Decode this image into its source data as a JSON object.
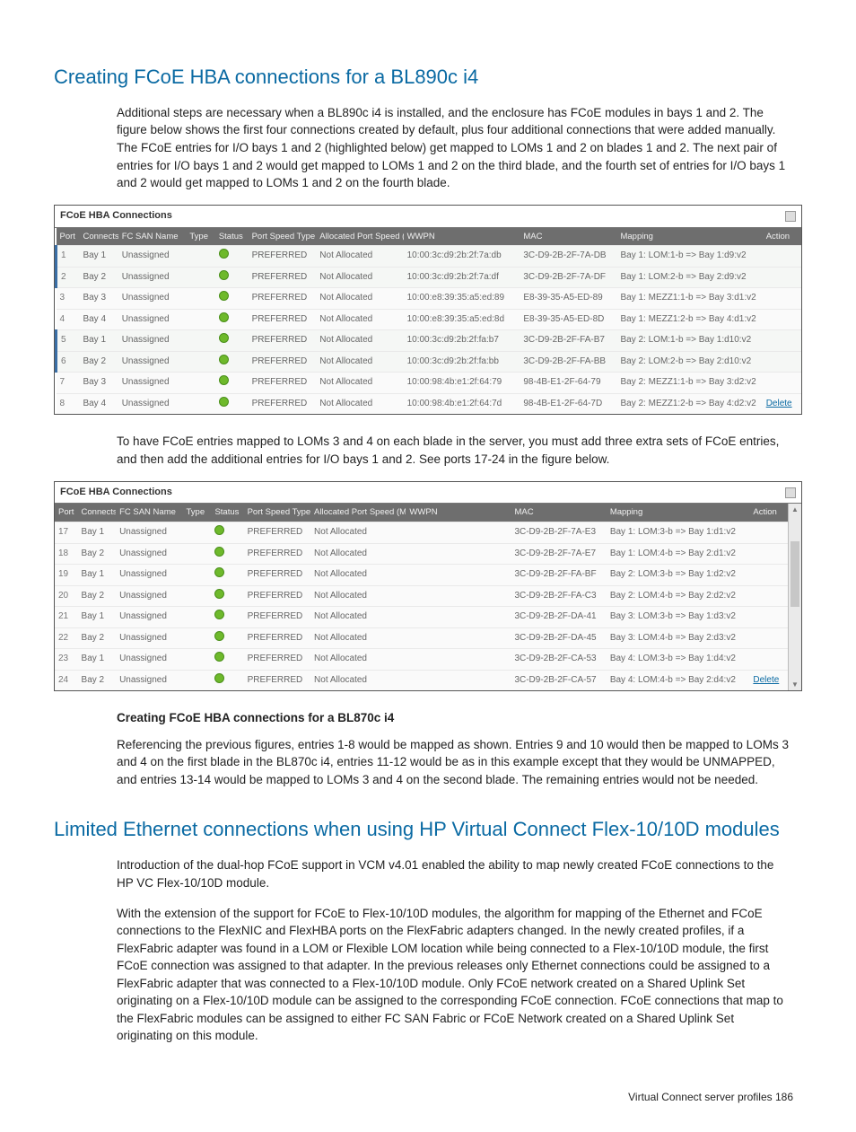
{
  "section1_title": "Creating FCoE HBA connections for a BL890c i4",
  "section1_p1": "Additional steps are necessary when a BL890c i4 is installed, and the enclosure has FCoE modules in bays 1 and 2. The figure below shows the first four connections created by default, plus four additional connections that were added manually. The FCoE entries for I/O bays 1 and 2 (highlighted below) get mapped to LOMs 1 and 2 on blades 1 and 2. The next pair of entries for I/O bays 1 and 2 would get mapped to LOMs 1 and 2 on the third blade, and the fourth set of entries for I/O bays 1 and 2 would get mapped to LOMs 1 and 2 on the fourth blade.",
  "fig1_title": "FCoE HBA Connections",
  "table_headers": {
    "port": "Port",
    "connects": "Connects",
    "fcsan": "FC SAN Name",
    "type": "Type",
    "status": "Status",
    "pst": "Port Speed Type",
    "aps": "Allocated Port Speed (Min-Max)",
    "wwpn": "WWPN",
    "mac": "MAC",
    "mapping": "Mapping",
    "action": "Action"
  },
  "fig1_rows": [
    {
      "port": "1",
      "hl": true,
      "bay": "Bay 1",
      "san": "Unassigned",
      "pst": "PREFERRED",
      "aps": "Not Allocated",
      "wwpn": "10:00:3c:d9:2b:2f:7a:db",
      "mac": "3C-D9-2B-2F-7A-DB",
      "map": "Bay 1: LOM:1-b => Bay 1:d9:v2",
      "del": false
    },
    {
      "port": "2",
      "hl": true,
      "bay": "Bay 2",
      "san": "Unassigned",
      "pst": "PREFERRED",
      "aps": "Not Allocated",
      "wwpn": "10:00:3c:d9:2b:2f:7a:df",
      "mac": "3C-D9-2B-2F-7A-DF",
      "map": "Bay 1: LOM:2-b => Bay 2:d9:v2",
      "del": false
    },
    {
      "port": "3",
      "hl": false,
      "bay": "Bay 3",
      "san": "Unassigned",
      "pst": "PREFERRED",
      "aps": "Not Allocated",
      "wwpn": "10:00:e8:39:35:a5:ed:89",
      "mac": "E8-39-35-A5-ED-89",
      "map": "Bay 1: MEZZ1:1-b => Bay 3:d1:v2",
      "del": false
    },
    {
      "port": "4",
      "hl": false,
      "bay": "Bay 4",
      "san": "Unassigned",
      "pst": "PREFERRED",
      "aps": "Not Allocated",
      "wwpn": "10:00:e8:39:35:a5:ed:8d",
      "mac": "E8-39-35-A5-ED-8D",
      "map": "Bay 1: MEZZ1:2-b => Bay 4:d1:v2",
      "del": false
    },
    {
      "port": "5",
      "hl": true,
      "bay": "Bay 1",
      "san": "Unassigned",
      "pst": "PREFERRED",
      "aps": "Not Allocated",
      "wwpn": "10:00:3c:d9:2b:2f:fa:b7",
      "mac": "3C-D9-2B-2F-FA-B7",
      "map": "Bay 2: LOM:1-b => Bay 1:d10:v2",
      "del": false
    },
    {
      "port": "6",
      "hl": true,
      "bay": "Bay 2",
      "san": "Unassigned",
      "pst": "PREFERRED",
      "aps": "Not Allocated",
      "wwpn": "10:00:3c:d9:2b:2f:fa:bb",
      "mac": "3C-D9-2B-2F-FA-BB",
      "map": "Bay 2: LOM:2-b => Bay 2:d10:v2",
      "del": false
    },
    {
      "port": "7",
      "hl": false,
      "bay": "Bay 3",
      "san": "Unassigned",
      "pst": "PREFERRED",
      "aps": "Not Allocated",
      "wwpn": "10:00:98:4b:e1:2f:64:79",
      "mac": "98-4B-E1-2F-64-79",
      "map": "Bay 2: MEZZ1:1-b => Bay 3:d2:v2",
      "del": false
    },
    {
      "port": "8",
      "hl": false,
      "bay": "Bay 4",
      "san": "Unassigned",
      "pst": "PREFERRED",
      "aps": "Not Allocated",
      "wwpn": "10:00:98:4b:e1:2f:64:7d",
      "mac": "98-4B-E1-2F-64-7D",
      "map": "Bay 2: MEZZ1:2-b => Bay 4:d2:v2",
      "del": true
    }
  ],
  "section1_p2": "To have FCoE entries mapped to LOMs 3 and 4 on each blade in the server, you must add three extra sets of FCoE entries, and then add the additional entries for I/O bays 1 and 2. See ports 17-24 in the figure below.",
  "fig2_title": "FCoE HBA Connections",
  "fig2_rows": [
    {
      "port": "17",
      "hl": false,
      "bay": "Bay 1",
      "san": "Unassigned",
      "pst": "PREFERRED",
      "aps": "Not Allocated",
      "wwpn": "",
      "mac": "3C-D9-2B-2F-7A-E3",
      "map": "Bay 1: LOM:3-b => Bay 1:d1:v2",
      "del": false
    },
    {
      "port": "18",
      "hl": false,
      "bay": "Bay 2",
      "san": "Unassigned",
      "pst": "PREFERRED",
      "aps": "Not Allocated",
      "wwpn": "",
      "mac": "3C-D9-2B-2F-7A-E7",
      "map": "Bay 1: LOM:4-b => Bay 2:d1:v2",
      "del": false
    },
    {
      "port": "19",
      "hl": false,
      "bay": "Bay 1",
      "san": "Unassigned",
      "pst": "PREFERRED",
      "aps": "Not Allocated",
      "wwpn": "",
      "mac": "3C-D9-2B-2F-FA-BF",
      "map": "Bay 2: LOM:3-b => Bay 1:d2:v2",
      "del": false
    },
    {
      "port": "20",
      "hl": false,
      "bay": "Bay 2",
      "san": "Unassigned",
      "pst": "PREFERRED",
      "aps": "Not Allocated",
      "wwpn": "",
      "mac": "3C-D9-2B-2F-FA-C3",
      "map": "Bay 2: LOM:4-b => Bay 2:d2:v2",
      "del": false
    },
    {
      "port": "21",
      "hl": false,
      "bay": "Bay 1",
      "san": "Unassigned",
      "pst": "PREFERRED",
      "aps": "Not Allocated",
      "wwpn": "",
      "mac": "3C-D9-2B-2F-DA-41",
      "map": "Bay 3: LOM:3-b => Bay 1:d3:v2",
      "del": false
    },
    {
      "port": "22",
      "hl": false,
      "bay": "Bay 2",
      "san": "Unassigned",
      "pst": "PREFERRED",
      "aps": "Not Allocated",
      "wwpn": "",
      "mac": "3C-D9-2B-2F-DA-45",
      "map": "Bay 3: LOM:4-b => Bay 2:d3:v2",
      "del": false
    },
    {
      "port": "23",
      "hl": false,
      "bay": "Bay 1",
      "san": "Unassigned",
      "pst": "PREFERRED",
      "aps": "Not Allocated",
      "wwpn": "",
      "mac": "3C-D9-2B-2F-CA-53",
      "map": "Bay 4: LOM:3-b => Bay 1:d4:v2",
      "del": false
    },
    {
      "port": "24",
      "hl": false,
      "bay": "Bay 2",
      "san": "Unassigned",
      "pst": "PREFERRED",
      "aps": "Not Allocated",
      "wwpn": "",
      "mac": "3C-D9-2B-2F-CA-57",
      "map": "Bay 4: LOM:4-b => Bay 2:d4:v2",
      "del": true
    }
  ],
  "sub_heading": "Creating FCoE HBA connections for a BL870c i4",
  "section1_p3": "Referencing the previous figures, entries 1-8 would be mapped as shown. Entries 9 and 10 would then be mapped to LOMs 3 and 4 on the first blade in the BL870c i4, entries 11-12 would be as in this example except that they would be UNMAPPED, and entries 13-14 would be mapped to LOMs 3 and 4 on the second blade. The remaining entries would not be needed.",
  "section2_title": "Limited Ethernet connections when using HP Virtual Connect Flex-10/10D modules",
  "section2_p1": "Introduction of the dual-hop FCoE support in VCM v4.01 enabled the ability to map newly created FCoE connections to the HP VC Flex-10/10D module.",
  "section2_p2": "With the extension of the support for FCoE to Flex-10/10D modules, the algorithm for mapping of the Ethernet and FCoE connections to the FlexNIC and FlexHBA ports on the FlexFabric adapters changed. In the newly created profiles, if a FlexFabric adapter was found in a LOM or Flexible LOM location while being connected to a Flex-10/10D module, the first FCoE connection was assigned to that adapter. In the previous releases only Ethernet connections could be assigned to a FlexFabric adapter that was connected to a Flex-10/10D module. Only FCoE network created on a Shared Uplink Set originating on a Flex-10/10D module can be assigned to the corresponding FCoE connection. FCoE connections that map to the FlexFabric modules can be assigned to either FC SAN Fabric or FCoE Network created on a Shared Uplink Set originating on this module.",
  "delete_label": "Delete",
  "footer": "Virtual Connect server profiles   186"
}
